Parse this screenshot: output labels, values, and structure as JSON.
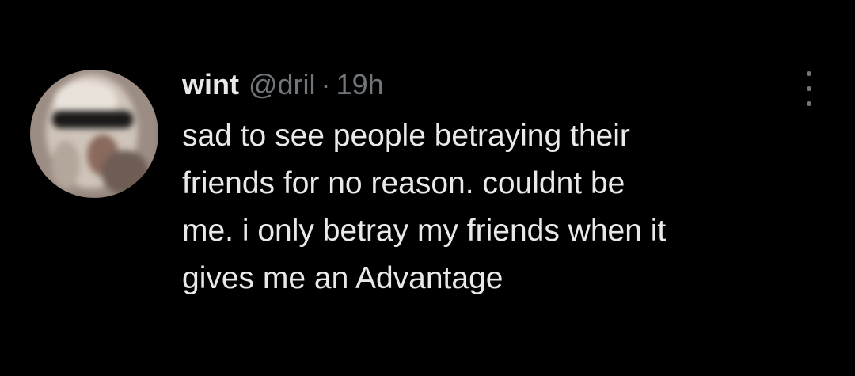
{
  "tweet": {
    "display_name": "wint",
    "handle": "@dril",
    "separator": "·",
    "timestamp": "19h",
    "text_lines": [
      "sad to see people betraying their",
      "friends for no reason. couldnt be",
      "me. i only betray my friends when it",
      "gives me an Advantage"
    ],
    "more_icon": "more-options-icon"
  },
  "colors": {
    "background": "#000000",
    "text_primary": "#e7e9ea",
    "text_secondary": "#71767b",
    "divider": "#2f3336"
  }
}
